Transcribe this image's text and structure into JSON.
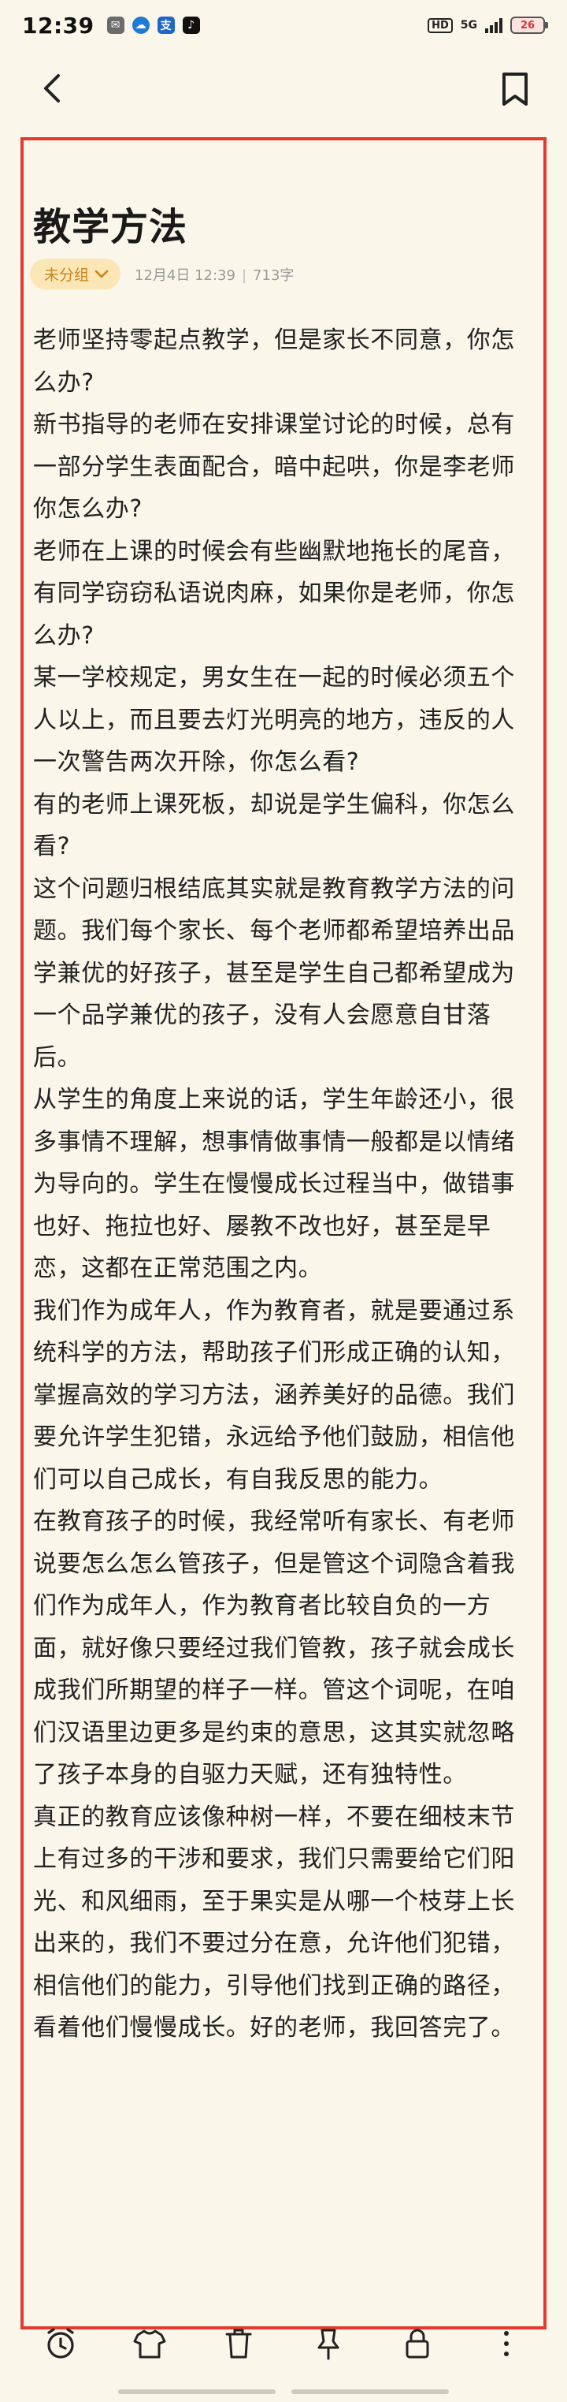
{
  "status_bar": {
    "time": "12:39",
    "hd": "HD",
    "network": "5G",
    "battery": "26"
  },
  "header": {
    "back_icon": "back-arrow-icon",
    "bookmark_icon": "bookmark-icon"
  },
  "note": {
    "title": "教学方法",
    "category": "未分组",
    "date": "12月4日 12:39",
    "char_count": "713字",
    "paragraphs": [
      "老师坚持零起点教学，但是家长不同意，你怎么办?",
      "新书指导的老师在安排课堂讨论的时候，总有一部分学生表面配合，暗中起哄，你是李老师你怎么办?",
      "老师在上课的时候会有些幽默地拖长的尾音，有同学窃窃私语说肉麻，如果你是老师，你怎么办?",
      "某一学校规定，男女生在一起的时候必须五个人以上，而且要去灯光明亮的地方，违反的人一次警告两次开除，你怎么看?",
      "有的老师上课死板，却说是学生偏科，你怎么看?",
      "这个问题归根结底其实就是教育教学方法的问题。我们每个家长、每个老师都希望培养出品学兼优的好孩子，甚至是学生自己都希望成为一个品学兼优的孩子，没有人会愿意自甘落后。",
      "从学生的角度上来说的话，学生年龄还小，很多事情不理解，想事情做事情一般都是以情绪为导向的。学生在慢慢成长过程当中，做错事也好、拖拉也好、屡教不改也好，甚至是早恋，这都在正常范围之内。",
      "我们作为成年人，作为教育者，就是要通过系统科学的方法，帮助孩子们形成正确的认知，掌握高效的学习方法，涵养美好的品德。我们要允许学生犯错，永远给予他们鼓励，相信他们可以自己成长，有自我反思的能力。",
      "在教育孩子的时候，我经常听有家长、有老师说要怎么怎么管孩子，但是管这个词隐含着我们作为成年人，作为教育者比较自负的一方面，就好像只要经过我们管教，孩子就会成长成我们所期望的样子一样。管这个词呢，在咱们汉语里边更多是约束的意思，这其实就忽略了孩子本身的自驱力天赋，还有独特性。",
      "真正的教育应该像种树一样，不要在细枝末节上有过多的干涉和要求，我们只需要给它们阳光、和风细雨，至于果实是从哪一个枝芽上长出来的，我们不要过分在意，允许他们犯错，相信他们的能力，引导他们找到正确的路径，看着他们慢慢成长。好的老师，我回答完了。"
    ]
  },
  "toolbar": {
    "icons": [
      "alarm-clock-icon",
      "shirt-icon",
      "trash-icon",
      "pin-icon",
      "lock-icon",
      "more-icon"
    ]
  },
  "colors": {
    "background": "#fbf6ea",
    "frame": "#e23b2e",
    "category_bg": "#fbe7b5",
    "category_text": "#c9831a"
  }
}
